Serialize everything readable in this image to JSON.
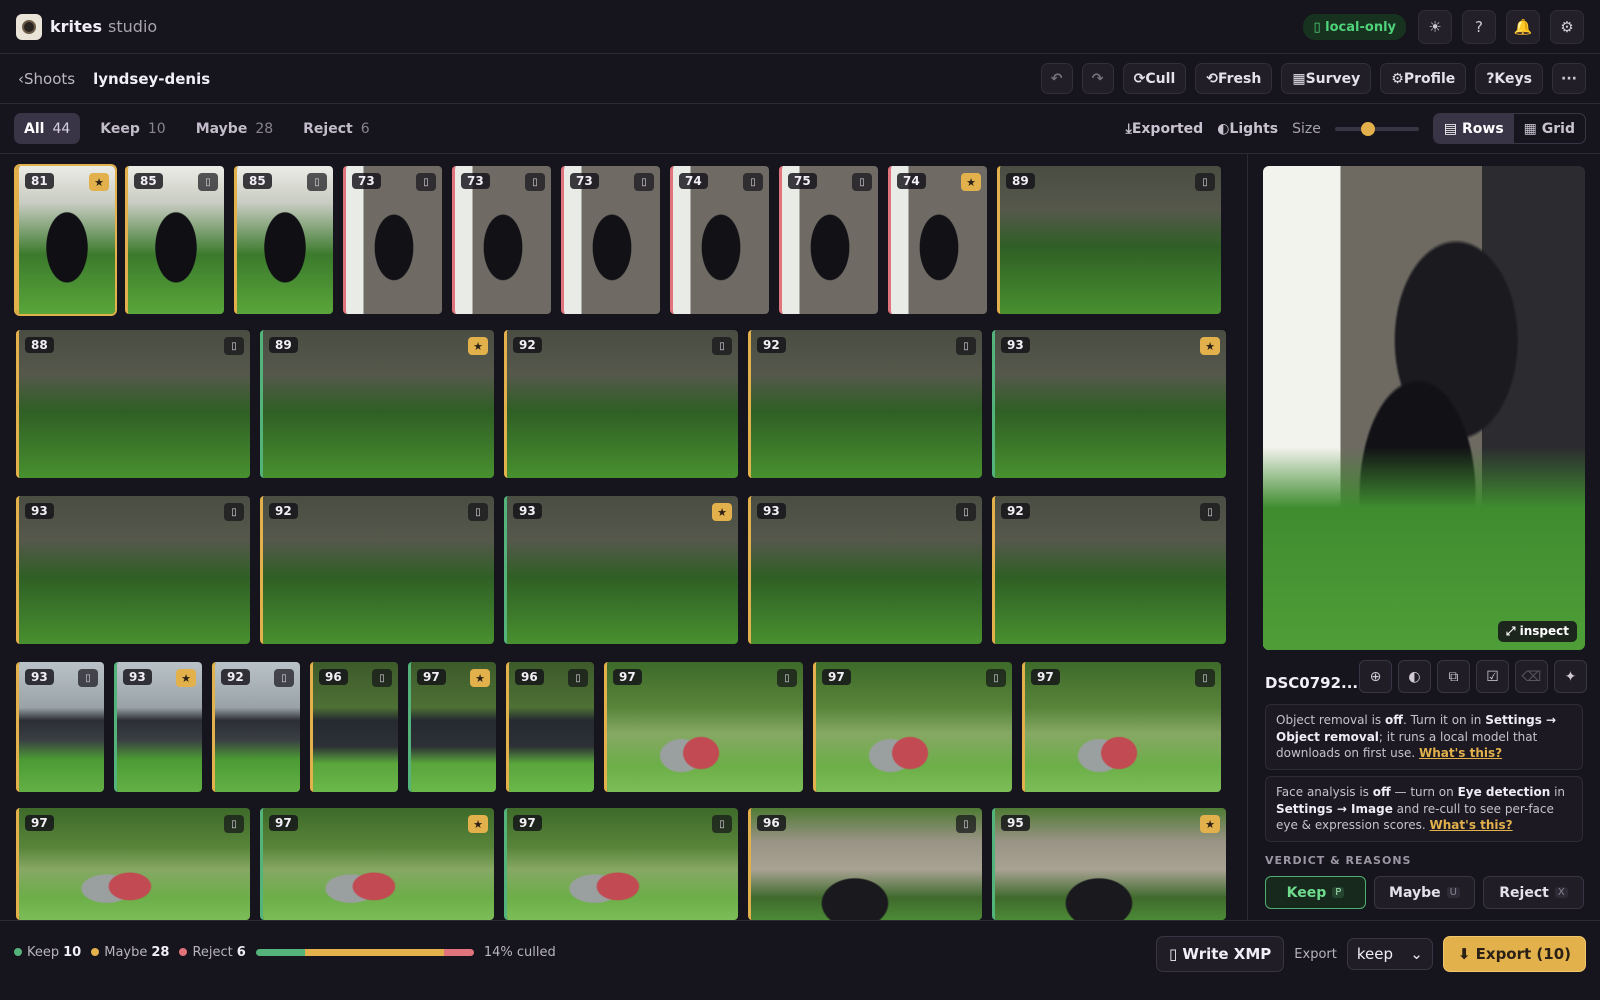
{
  "app": {
    "name": "krites",
    "sub": "studio"
  },
  "header": {
    "local_pill": "▯ local-only",
    "icons": [
      {
        "name": "theme-icon",
        "glyph": "☀"
      },
      {
        "name": "help-icon",
        "glyph": "?"
      },
      {
        "name": "bell-icon",
        "glyph": "🔔"
      },
      {
        "name": "settings-icon",
        "glyph": "⚙"
      }
    ]
  },
  "shoot": {
    "back": "‹Shoots",
    "name": "lyndsey-denis",
    "undo": "↶",
    "redo": "↷",
    "actions": [
      "⟳Cull",
      "⟲Fresh",
      "▦Survey",
      "⚙Profile",
      "?Keys"
    ],
    "more": "···"
  },
  "filters": {
    "tabs": [
      {
        "label": "All",
        "count": "44"
      },
      {
        "label": "Keep",
        "count": "10"
      },
      {
        "label": "Maybe",
        "count": "28"
      },
      {
        "label": "Reject",
        "count": "6"
      }
    ],
    "exported": "⤓Exported",
    "lights": "◐Lights",
    "size_label": "Size",
    "size_value": 0.4,
    "view_rows": "▤ Rows",
    "view_grid": "▦ Grid"
  },
  "thumbnails": [
    {
      "score": "81",
      "star": true,
      "verdict": "maybe",
      "style": "ph-portrait",
      "selected": true
    },
    {
      "score": "85",
      "star": false,
      "verdict": "maybe",
      "style": "ph-portrait"
    },
    {
      "score": "85",
      "star": false,
      "verdict": "maybe",
      "style": "ph-portrait"
    },
    {
      "score": "73",
      "star": false,
      "verdict": "reject",
      "style": "ph-wall"
    },
    {
      "score": "73",
      "star": false,
      "verdict": "reject",
      "style": "ph-wall"
    },
    {
      "score": "73",
      "star": false,
      "verdict": "reject",
      "style": "ph-wall"
    },
    {
      "score": "74",
      "star": false,
      "verdict": "reject",
      "style": "ph-wall"
    },
    {
      "score": "75",
      "star": false,
      "verdict": "reject",
      "style": "ph-wall"
    },
    {
      "score": "74",
      "star": true,
      "verdict": "reject",
      "style": "ph-wall"
    },
    {
      "score": "89",
      "star": false,
      "verdict": "maybe",
      "style": "ph-grass"
    },
    {
      "score": "88",
      "star": false,
      "verdict": "maybe",
      "style": "ph-grass"
    },
    {
      "score": "89",
      "star": true,
      "verdict": "keep",
      "style": "ph-grass"
    },
    {
      "score": "92",
      "star": false,
      "verdict": "maybe",
      "style": "ph-grass"
    },
    {
      "score": "92",
      "star": false,
      "verdict": "maybe",
      "style": "ph-grass"
    },
    {
      "score": "93",
      "star": true,
      "verdict": "keep",
      "style": "ph-grass"
    },
    {
      "score": "93",
      "star": false,
      "verdict": "maybe",
      "style": "ph-grass"
    },
    {
      "score": "92",
      "star": false,
      "verdict": "maybe",
      "style": "ph-grass"
    },
    {
      "score": "93",
      "star": true,
      "verdict": "keep",
      "style": "ph-grass"
    },
    {
      "score": "93",
      "star": false,
      "verdict": "maybe",
      "style": "ph-grass"
    },
    {
      "score": "92",
      "star": false,
      "verdict": "maybe",
      "style": "ph-grass"
    },
    {
      "score": "93",
      "star": false,
      "verdict": "maybe",
      "style": "ph-group"
    },
    {
      "score": "93",
      "star": true,
      "verdict": "keep",
      "style": "ph-group"
    },
    {
      "score": "92",
      "star": false,
      "verdict": "maybe",
      "style": "ph-group"
    },
    {
      "score": "96",
      "star": false,
      "verdict": "maybe",
      "style": "ph-trees"
    },
    {
      "score": "97",
      "star": true,
      "verdict": "keep",
      "style": "ph-trees"
    },
    {
      "score": "96",
      "star": false,
      "verdict": "maybe",
      "style": "ph-trees"
    },
    {
      "score": "97",
      "star": false,
      "verdict": "maybe",
      "style": "ph-ladies"
    },
    {
      "score": "97",
      "star": false,
      "verdict": "maybe",
      "style": "ph-ladies"
    },
    {
      "score": "97",
      "star": false,
      "verdict": "maybe",
      "style": "ph-ladies"
    },
    {
      "score": "97",
      "star": false,
      "verdict": "maybe",
      "style": "ph-ladies"
    },
    {
      "score": "97",
      "star": true,
      "verdict": "keep",
      "style": "ph-ladies"
    },
    {
      "score": "97",
      "star": false,
      "verdict": "keep",
      "style": "ph-ladies"
    },
    {
      "score": "96",
      "star": false,
      "verdict": "maybe",
      "style": "ph-couple"
    },
    {
      "score": "95",
      "star": true,
      "verdict": "keep",
      "style": "ph-couple"
    }
  ],
  "icons": {
    "star": "★",
    "flag": "▯"
  },
  "panel": {
    "inspect": "⤢ inspect",
    "filename": "DSC0792...",
    "tools": [
      {
        "name": "focus-icon",
        "glyph": "⊕"
      },
      {
        "name": "contrast-icon",
        "glyph": "◐"
      },
      {
        "name": "duplicate-icon",
        "glyph": "⧉"
      },
      {
        "name": "check-icon",
        "glyph": "☑"
      },
      {
        "name": "eraser-icon",
        "glyph": "⌫"
      },
      {
        "name": "sparkle-icon",
        "glyph": "✦"
      }
    ],
    "note1": {
      "t1": "Object removal is ",
      "b1": "off",
      "t2": ". Turn it on in ",
      "b2": "Settings → Object removal",
      "t3": "; it runs a local model that downloads on first use. ",
      "link": "What's this?"
    },
    "note2": {
      "t1": "Face analysis is ",
      "b1": "off",
      "t2": " — turn on ",
      "b2": "Eye detection",
      "t3": " in ",
      "b3": "Settings → Image",
      "t4": " and re-cull to see per-face eye & expression scores. ",
      "link": "What's this?"
    },
    "verdict_title": "VERDICT & REASONS",
    "verdicts": [
      {
        "label": "Keep",
        "key": "P"
      },
      {
        "label": "Maybe",
        "key": "U"
      },
      {
        "label": "Reject",
        "key": "X"
      }
    ]
  },
  "footer": {
    "keep_label": "Keep",
    "keep_count": "10",
    "maybe_label": "Maybe",
    "maybe_count": "28",
    "reject_label": "Reject",
    "reject_count": "6",
    "culled": "14% culled",
    "progress": {
      "keep": 10,
      "maybe": 28,
      "reject": 6
    },
    "xmp": "▯ Write XMP",
    "export_label": "Export",
    "export_select": "keep",
    "export_button": "⬇ Export (10)"
  },
  "colors": {
    "keep": "#53b37a",
    "maybe": "#e2b14c",
    "reject": "#e0737b",
    "accent": "#e2b14c"
  }
}
